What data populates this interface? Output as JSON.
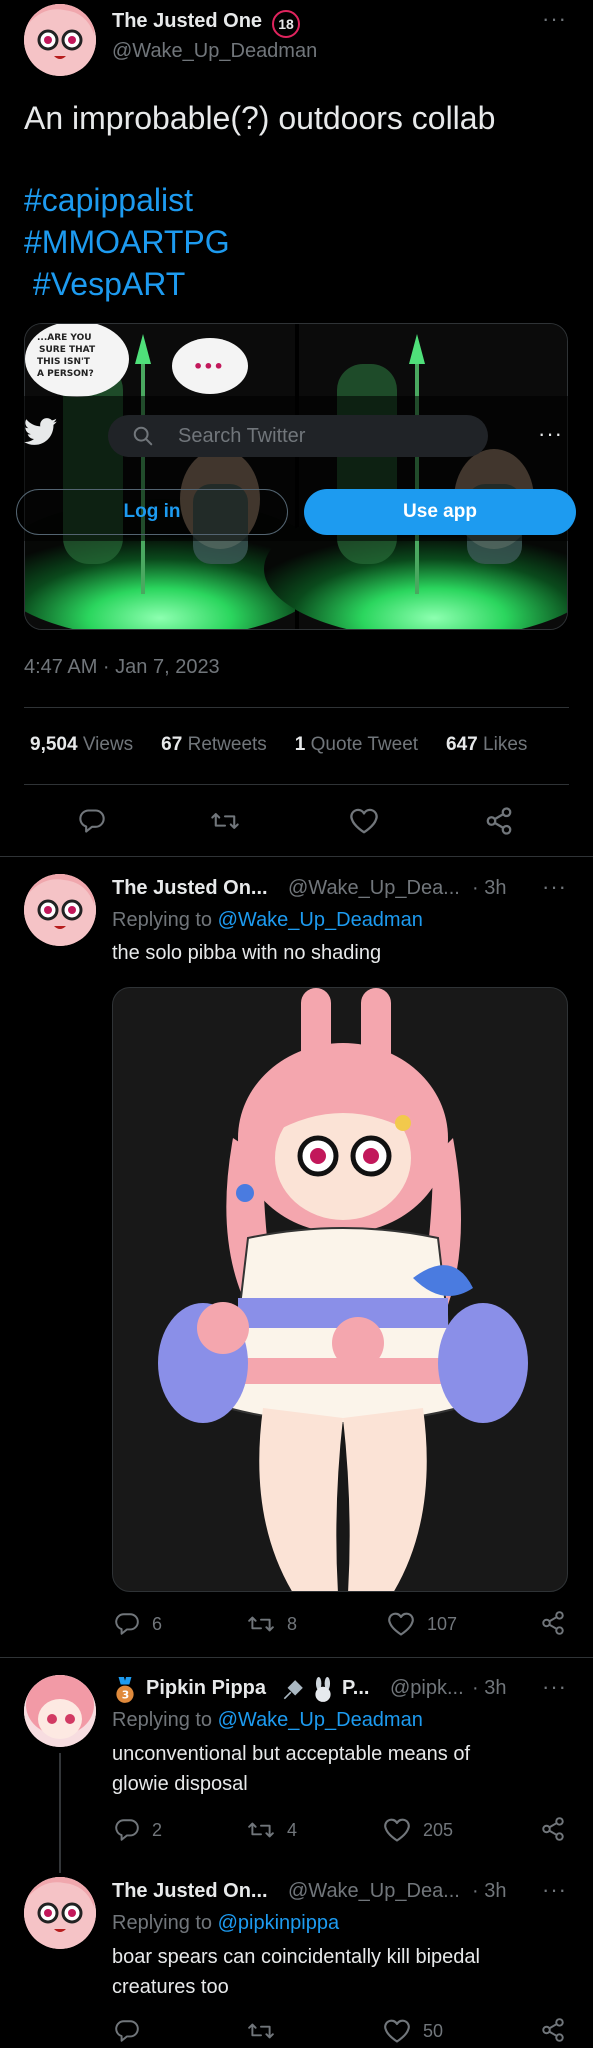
{
  "main_tweet": {
    "author_name": "The Justed One",
    "age_badge": "18",
    "author_handle": "@Wake_Up_Deadman",
    "text": "An improbable(?) outdoors collab",
    "hashtags": [
      "#capippalist",
      "#MMOARTPG",
      " #VespART"
    ],
    "speech_bubble_1": "...ARE YOU SURE THAT THIS ISN'T A PERSON?",
    "speech_bubble_2": "•••",
    "timestamp": "4:47 AM · Jan 7, 2023",
    "stats": {
      "views_count": "9,504",
      "views_label": "Views",
      "retweets_count": "67",
      "retweets_label": "Retweets",
      "quotes_count": "1",
      "quotes_label": "Quote Tweet",
      "likes_count": "647",
      "likes_label": "Likes"
    }
  },
  "overlay": {
    "search_placeholder": "Search Twitter",
    "login_label": "Log in",
    "use_app_label": "Use app"
  },
  "replies": [
    {
      "author_name": "The Justed On...",
      "author_handle": "@Wake_Up_Dea...",
      "time": "· 3h",
      "replying_prefix": "Replying to ",
      "replying_to": "@Wake_Up_Deadman",
      "text": "the solo pibba with no shading",
      "reply_count": "6",
      "retweet_count": "8",
      "like_count": "107"
    },
    {
      "author_name": "Pipkin Pippa",
      "author_suffix": "P...",
      "author_handle": "@pipk...",
      "time": "· 3h",
      "replying_prefix": "Replying to ",
      "replying_to": "@Wake_Up_Deadman",
      "text": "unconventional but acceptable means of glowie disposal",
      "reply_count": "2",
      "retweet_count": "4",
      "like_count": "205"
    },
    {
      "author_name": "The Justed On...",
      "author_handle": "@Wake_Up_Dea...",
      "time": "· 3h",
      "replying_prefix": "Replying to ",
      "replying_to": "@pipkinpippa",
      "text": "boar spears can coincidentally kill bipedal creatures too",
      "reply_count": "",
      "retweet_count": "",
      "like_count": "50"
    }
  ],
  "colors": {
    "accent": "#1d9bf0",
    "background": "#000000",
    "muted": "#71767b",
    "divider": "#2f3336",
    "glow": "#37ff7a"
  }
}
